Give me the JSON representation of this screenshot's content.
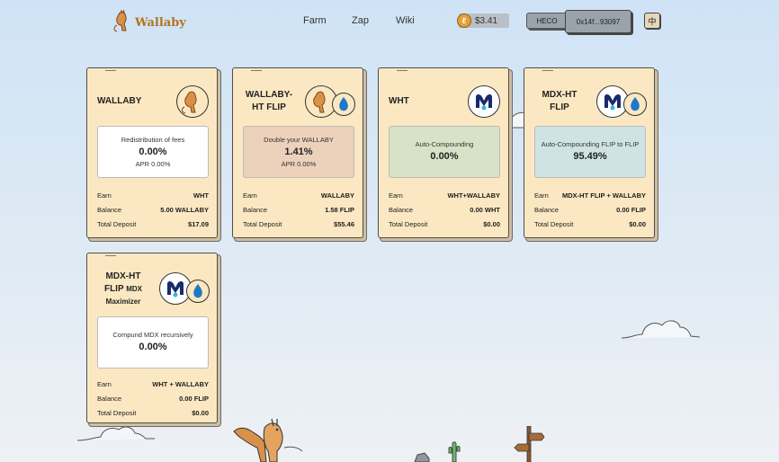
{
  "header": {
    "brand": "Wallaby",
    "nav": [
      {
        "label": "Farm"
      },
      {
        "label": "Zap"
      },
      {
        "label": "Wiki"
      }
    ],
    "price": "$3.41",
    "network": "HECO",
    "wallet": "0x14f...93097",
    "language": "中"
  },
  "colors": {
    "card_bg": "#fbe8c2",
    "box_white": "#ffffff",
    "box_peach": "#ecd1bb",
    "box_green": "#d7e3c7",
    "box_teal": "#cfe4e2",
    "accent": "#b5731f"
  },
  "cards": [
    {
      "title": "WALLABY",
      "description": "Redistribution of fees",
      "value": "0.00%",
      "apr": "APR 0.00%",
      "rows": [
        {
          "label": "Earn",
          "value": "WHT"
        },
        {
          "label": "Balance",
          "value": "5.00 WALLABY"
        },
        {
          "label": "Total Deposit",
          "value": "$17.09"
        }
      ],
      "icons": [
        "wallaby-token-icon"
      ]
    },
    {
      "title_line1": "WALLABY-",
      "title_line2": "HT FLIP",
      "description": "Double your WALLABY",
      "value": "1.41%",
      "apr": "APR 0.00%",
      "rows": [
        {
          "label": "Earn",
          "value": "WALLABY"
        },
        {
          "label": "Balance",
          "value": "1.58 FLIP"
        },
        {
          "label": "Total Deposit",
          "value": "$55.46"
        }
      ],
      "icons": [
        "wallaby-token-icon",
        "ht-token-icon"
      ]
    },
    {
      "title": "WHT",
      "description": "Auto-Compounding",
      "value": "0.00%",
      "rows": [
        {
          "label": "Earn",
          "value": "WHT+WALLABY"
        },
        {
          "label": "Balance",
          "value": "0.00 WHT"
        },
        {
          "label": "Total Deposit",
          "value": "$0.00"
        }
      ],
      "icons": [
        "mdx-token-icon"
      ]
    },
    {
      "title_line1": "MDX-HT",
      "title_line2": "FLIP",
      "description": "Auto-Compounding FLIP to FLIP",
      "value": "95.49%",
      "rows": [
        {
          "label": "Earn",
          "value": "MDX-HT FLIP + WALLABY"
        },
        {
          "label": "Balance",
          "value": "0.00 FLIP"
        },
        {
          "label": "Total Deposit",
          "value": "$0.00"
        }
      ],
      "icons": [
        "mdx-token-icon",
        "ht-token-icon"
      ]
    },
    {
      "title_line1": "MDX-HT",
      "title_line2a": "FLIP",
      "title_line2b": "MDX",
      "title_line3": "Maximizer",
      "description": "Compund MDX recursively",
      "value": "0.00%",
      "rows": [
        {
          "label": "Earn",
          "value": "WHT + WALLABY"
        },
        {
          "label": "Balance",
          "value": "0.00 FLIP"
        },
        {
          "label": "Total Deposit",
          "value": "$0.00"
        }
      ],
      "icons": [
        "mdx-token-icon",
        "ht-token-icon"
      ]
    }
  ]
}
